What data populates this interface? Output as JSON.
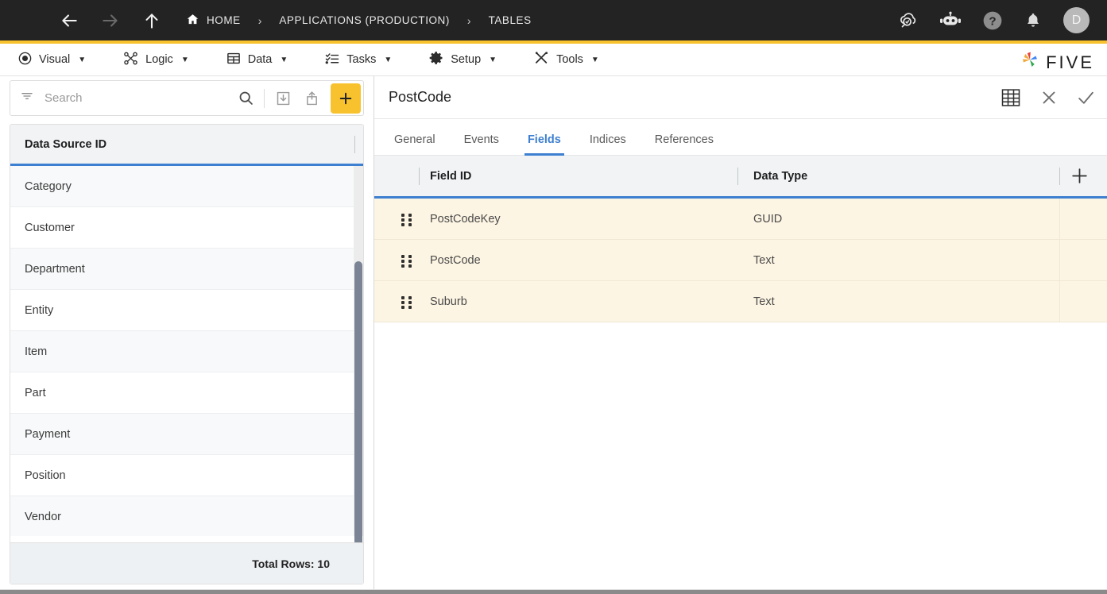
{
  "topbar": {
    "menu_icon": "hamburger-icon",
    "back_icon": "arrow-left-icon",
    "forward_icon": "arrow-right-icon",
    "up_icon": "arrow-up-icon",
    "breadcrumbs": [
      {
        "label": "HOME",
        "icon": "home-icon"
      },
      {
        "label": "APPLICATIONS (PRODUCTION)"
      },
      {
        "label": "TABLES"
      }
    ],
    "separator": "›",
    "right_icons": [
      {
        "name": "cloud-search-icon"
      },
      {
        "name": "chatbot-icon"
      },
      {
        "name": "help-icon"
      },
      {
        "name": "notifications-bell-icon"
      }
    ],
    "avatar_initial": "D",
    "accent_color": "#f8c22e",
    "background_color": "#232323"
  },
  "menubar": {
    "items": [
      {
        "label": "Visual",
        "icon": "eye-icon",
        "caret": "▼"
      },
      {
        "label": "Logic",
        "icon": "logic-nodes-icon",
        "caret": "▼"
      },
      {
        "label": "Data",
        "icon": "table-grid-icon",
        "caret": "▼"
      },
      {
        "label": "Tasks",
        "icon": "checklist-icon",
        "caret": "▼"
      },
      {
        "label": "Setup",
        "icon": "gear-icon",
        "caret": "▼"
      },
      {
        "label": "Tools",
        "icon": "tools-icon",
        "caret": "▼"
      }
    ],
    "logo_text": "FIVE"
  },
  "left_panel": {
    "search": {
      "placeholder": "Search",
      "value": "",
      "filter_icon": "filter-icon",
      "search_icon": "search-icon",
      "import_icon": "import-icon",
      "export_icon": "export-icon",
      "add_label": "+"
    },
    "list": {
      "column_header": "Data Source ID",
      "items": [
        {
          "label": "Category"
        },
        {
          "label": "Customer"
        },
        {
          "label": "Department"
        },
        {
          "label": "Entity"
        },
        {
          "label": "Item"
        },
        {
          "label": "Part"
        },
        {
          "label": "Payment"
        },
        {
          "label": "Position"
        },
        {
          "label": "Vendor"
        }
      ],
      "footer_text": "Total Rows: 10"
    }
  },
  "right_panel": {
    "title": "PostCode",
    "actions": [
      {
        "name": "grid-view-icon"
      },
      {
        "name": "close-icon"
      },
      {
        "name": "confirm-check-icon"
      }
    ],
    "tabs": [
      {
        "label": "General",
        "active": false
      },
      {
        "label": "Events",
        "active": false
      },
      {
        "label": "Fields",
        "active": true
      },
      {
        "label": "Indices",
        "active": false
      },
      {
        "label": "References",
        "active": false
      }
    ],
    "fields_table": {
      "columns": [
        "Field ID",
        "Data Type"
      ],
      "add_icon": "add-field-icon",
      "rows": [
        {
          "drag": "drag-handle-icon",
          "field_id": "PostCodeKey",
          "data_type": "GUID"
        },
        {
          "drag": "drag-handle-icon",
          "field_id": "PostCode",
          "data_type": "Text"
        },
        {
          "drag": "drag-handle-icon",
          "field_id": "Suburb",
          "data_type": "Text"
        }
      ]
    }
  },
  "colors": {
    "accent_yellow": "#f8c22e",
    "accent_blue": "#3d7fd1",
    "row_highlight": "#fdf5e3",
    "header_gray": "#f1f3f5",
    "dark_bar": "#232323"
  }
}
